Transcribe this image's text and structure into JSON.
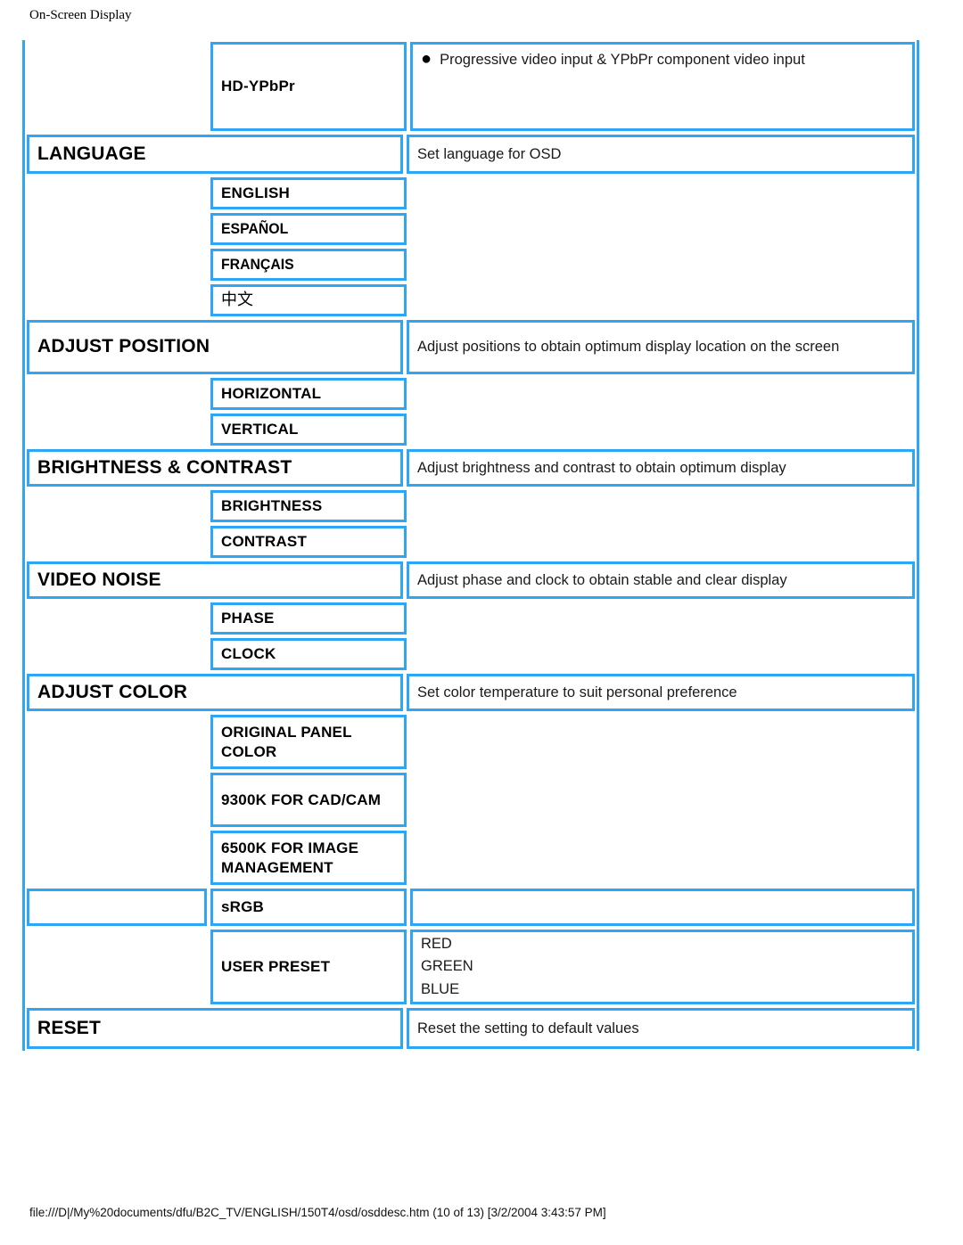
{
  "page": {
    "header": "On-Screen Display",
    "footer": "file:///D|/My%20documents/dfu/B2C_TV/ENGLISH/150T4/osd/osddesc.htm (10 of 13) [3/2/2004 3:43:57 PM]"
  },
  "colors": {
    "border_blue": "#2CA6F5",
    "text_black": "#000000",
    "background": "#FFFFFF"
  },
  "table": {
    "rows": [
      {
        "type": "sub",
        "col1": "",
        "col2": "HD-YPbPr",
        "col3_bullet": "Progressive video input & YPbPr component video input"
      },
      {
        "type": "main",
        "col12": "LANGUAGE",
        "col3": "Set language for OSD"
      },
      {
        "type": "option",
        "col2": "ENGLISH"
      },
      {
        "type": "option",
        "col2": "ESPAÑOL"
      },
      {
        "type": "option",
        "col2": "FRANÇAIS"
      },
      {
        "type": "option",
        "col2": "中文"
      },
      {
        "type": "main",
        "col12": "ADJUST POSITION",
        "col3": "Adjust positions to obtain optimum display location on the screen"
      },
      {
        "type": "option",
        "col2": "HORIZONTAL"
      },
      {
        "type": "option",
        "col2": "VERTICAL"
      },
      {
        "type": "main",
        "col12": "BRIGHTNESS & CONTRAST",
        "col3": "Adjust brightness and contrast to obtain optimum display"
      },
      {
        "type": "option",
        "col2": "BRIGHTNESS"
      },
      {
        "type": "option",
        "col2": "CONTRAST"
      },
      {
        "type": "main",
        "col12": "VIDEO NOISE",
        "col3": "Adjust phase and clock to obtain stable and clear display"
      },
      {
        "type": "option",
        "col2": "PHASE"
      },
      {
        "type": "option",
        "col2": "CLOCK"
      },
      {
        "type": "main",
        "col12": "ADJUST COLOR",
        "col3": "Set color temperature to suit personal preference"
      },
      {
        "type": "option",
        "col2": "ORIGINAL PANEL COLOR"
      },
      {
        "type": "option",
        "col2": "9300K FOR CAD/CAM"
      },
      {
        "type": "option",
        "col2": "6500K FOR IMAGE MANAGEMENT"
      },
      {
        "type": "option_bordered_c1",
        "col2": "sRGB",
        "col3": ""
      },
      {
        "type": "preset",
        "col2": "USER PRESET",
        "col3_lines": [
          "RED",
          "GREEN",
          "BLUE"
        ]
      },
      {
        "type": "main",
        "col12": "RESET",
        "col3": "Reset the setting to default values"
      }
    ]
  },
  "labels": {
    "hd_ypbpr": "HD-YPbPr",
    "hd_ypbpr_desc": "Progressive video input & YPbPr component video input",
    "language": "LANGUAGE",
    "language_desc": "Set language for OSD",
    "lang_english": "ENGLISH",
    "lang_espanol": "ESPAÑOL",
    "lang_francais": "FRANÇAIS",
    "lang_chinese": "中文",
    "adjust_position": "ADJUST POSITION",
    "adjust_position_desc": "Adjust positions to obtain optimum display location on the screen",
    "horizontal": "HORIZONTAL",
    "vertical": "VERTICAL",
    "brightness_contrast": "BRIGHTNESS & CONTRAST",
    "brightness_contrast_desc": "Adjust brightness and contrast to obtain optimum display",
    "brightness": "BRIGHTNESS",
    "contrast": "CONTRAST",
    "video_noise": "VIDEO NOISE",
    "video_noise_desc": "Adjust phase and clock to obtain stable and clear display",
    "phase": "PHASE",
    "clock": "CLOCK",
    "adjust_color": "ADJUST COLOR",
    "adjust_color_desc": "Set color temperature to suit personal preference",
    "original_panel_color": "ORIGINAL PANEL COLOR",
    "k9300_cad_cam": "9300K FOR CAD/CAM",
    "k6500_image_mgmt": "6500K FOR IMAGE MANAGEMENT",
    "srgb": "sRGB",
    "user_preset": "USER PRESET",
    "preset_red": "RED",
    "preset_green": "GREEN",
    "preset_blue": "BLUE",
    "reset": "RESET",
    "reset_desc": "Reset the setting to default values",
    "bullet_glyph": "●"
  }
}
